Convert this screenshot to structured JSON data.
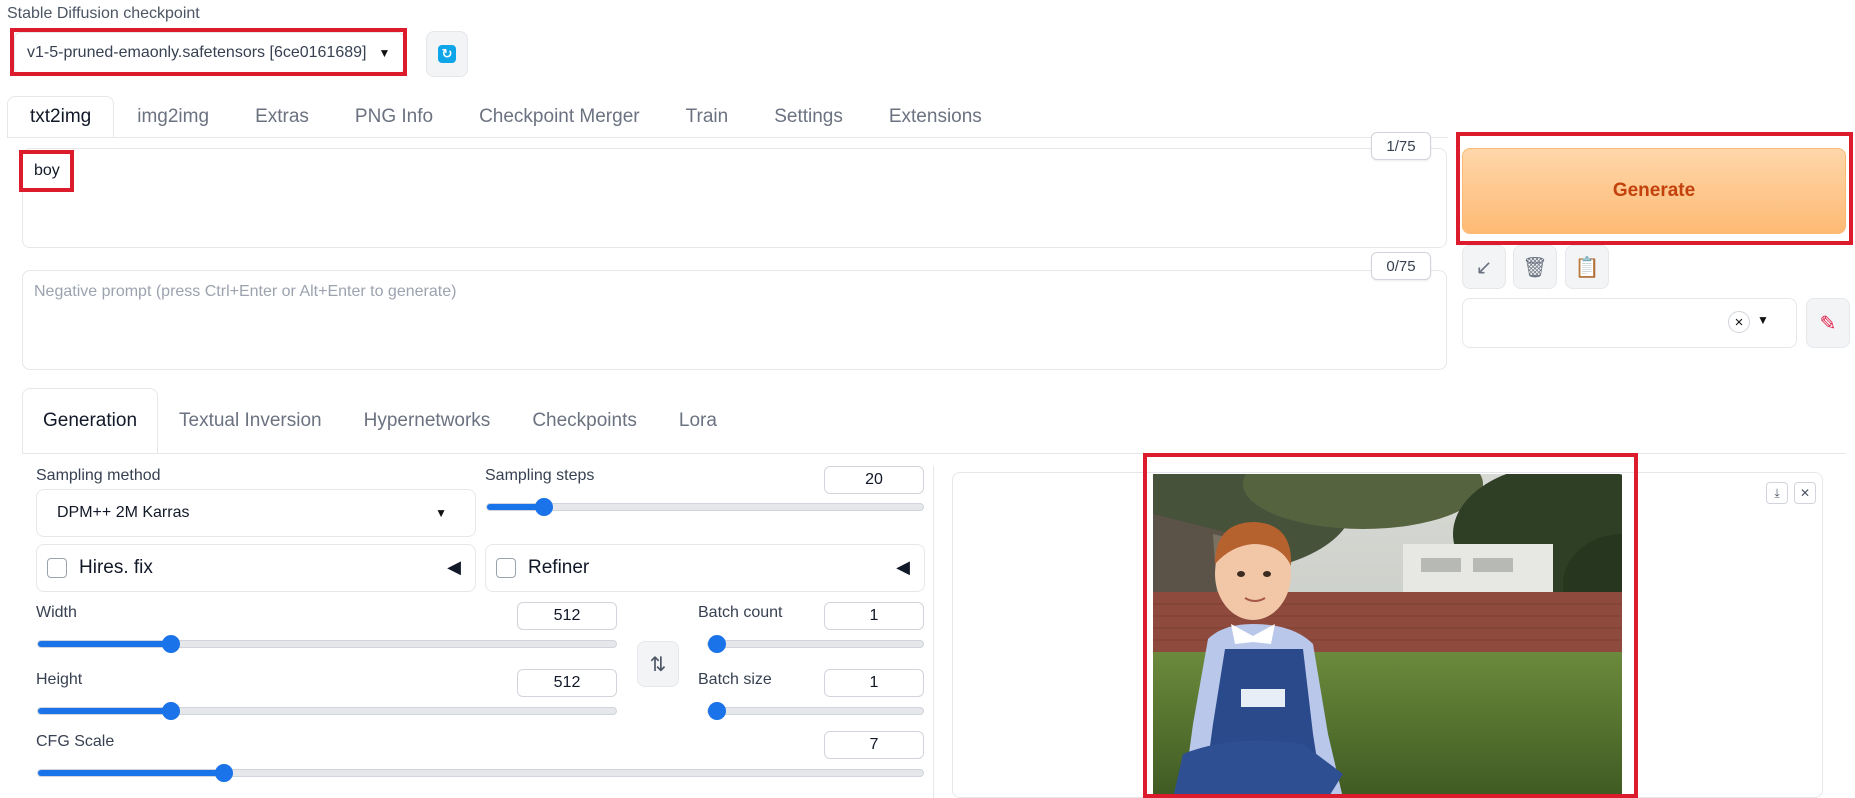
{
  "checkpoint": {
    "label": "Stable Diffusion checkpoint",
    "value": "v1-5-pruned-emaonly.safetensors [6ce0161689]",
    "refresh_icon": "refresh-icon"
  },
  "tabs": [
    {
      "label": "txt2img",
      "active": true
    },
    {
      "label": "img2img"
    },
    {
      "label": "Extras"
    },
    {
      "label": "PNG Info"
    },
    {
      "label": "Checkpoint Merger"
    },
    {
      "label": "Train"
    },
    {
      "label": "Settings"
    },
    {
      "label": "Extensions"
    }
  ],
  "prompt": {
    "value": "boy",
    "counter": "1/75"
  },
  "negative_prompt": {
    "value": "",
    "placeholder": "Negative prompt (press Ctrl+Enter or Alt+Enter to generate)",
    "counter": "0/75"
  },
  "generate_label": "Generate",
  "tools": [
    "arrow-icon",
    "trash-icon",
    "clipboard-icon"
  ],
  "styles": {
    "clear": "×"
  },
  "subtabs": [
    {
      "label": "Generation",
      "active": true
    },
    {
      "label": "Textual Inversion"
    },
    {
      "label": "Hypernetworks"
    },
    {
      "label": "Checkpoints"
    },
    {
      "label": "Lora"
    }
  ],
  "sampling": {
    "method_label": "Sampling method",
    "method_value": "DPM++ 2M Karras",
    "steps_label": "Sampling steps",
    "steps_value": "20",
    "steps_fraction": 0.13
  },
  "hires": {
    "label": "Hires. fix",
    "checked": false
  },
  "refiner": {
    "label": "Refiner",
    "checked": false
  },
  "width": {
    "label": "Width",
    "value": "512",
    "fraction": 0.23
  },
  "height": {
    "label": "Height",
    "value": "512",
    "fraction": 0.23
  },
  "batch_count": {
    "label": "Batch count",
    "value": "1",
    "fraction": 0.0
  },
  "batch_size": {
    "label": "Batch size",
    "value": "1",
    "fraction": 0.0
  },
  "cfg": {
    "label": "CFG Scale",
    "value": "7",
    "fraction": 0.21
  },
  "colors": {
    "accent": "#1a73e8",
    "generate_text": "#c2410c",
    "highlight": "#dc1c2c"
  }
}
